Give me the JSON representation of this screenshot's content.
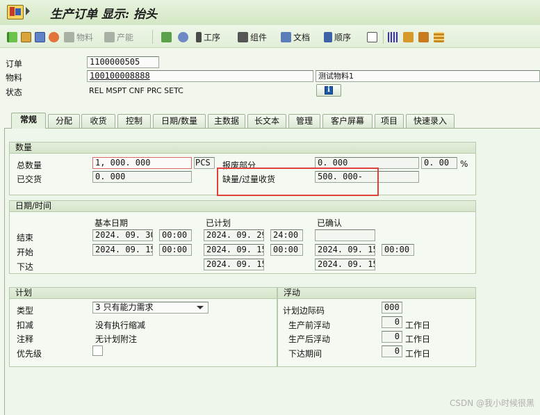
{
  "window": {
    "title": "生产订单 显示: 抬头"
  },
  "toolbar": {
    "material_label": "物料",
    "capacity_label": "产能",
    "operations_label": "工序",
    "components_label": "组件",
    "documents_label": "文档",
    "sequence_label": "顺序"
  },
  "header": {
    "order_label": "订单",
    "order_value": "1100000505",
    "material_label": "物料",
    "material_value": "100100008888",
    "material_desc": "测试物料1",
    "status_label": "状态",
    "status_value": "REL  MSPT CNF  PRC  SETC"
  },
  "tabs": [
    "常规",
    "分配",
    "收货",
    "控制",
    "日期/数量",
    "主数据",
    "长文本",
    "管理",
    "客户屏幕",
    "项目",
    "快速录入"
  ],
  "quantity": {
    "title": "数量",
    "total_label": "总数量",
    "total_value": "1, 000. 000",
    "unit": "PCS",
    "scrap_label": "报废部分",
    "scrap_value": "0. 000",
    "scrap_pct": "0. 00",
    "pct_sign": "%",
    "delivered_label": "已交货",
    "delivered_value": "0. 000",
    "shortage_label": "缺量/过量收货",
    "shortage_value": "500. 000-"
  },
  "dates": {
    "title": "日期/时间",
    "col_basic": "基本日期",
    "col_scheduled": "已计划",
    "col_confirmed": "已确认",
    "end_label": "结束",
    "start_label": "开始",
    "release_label": "下达",
    "end_basic_date": "2024. 09. 30",
    "end_basic_time": "00:00",
    "end_sched_date": "2024. 09. 29",
    "end_sched_time": "24:00",
    "start_basic_date": "2024. 09. 15",
    "start_basic_time": "00:00",
    "start_sched_date": "2024. 09. 15",
    "start_sched_time": "00:00",
    "start_conf_date": "2024. 09. 15",
    "start_conf_time": "00:00",
    "release_sched_date": "2024. 09. 15",
    "release_conf_date": "2024. 09. 15"
  },
  "planning": {
    "title": "计划",
    "type_label": "类型",
    "type_value": "3 只有能力需求",
    "reduction_label": "扣减",
    "reduction_value": "没有执行缩减",
    "note_label": "注释",
    "note_value": "无计划附注",
    "priority_label": "优先级"
  },
  "float": {
    "title": "浮动",
    "margin_key_label": "计划边际码",
    "margin_key_value": "000",
    "before_label": "生产前浮动",
    "before_value": "0",
    "after_label": "生产后浮动",
    "after_value": "0",
    "release_label": "下达期间",
    "release_value": "0",
    "workdays": "工作日"
  },
  "watermark": "CSDN @我小时候很黑",
  "colors": {
    "accent_red": "#e0403a",
    "background": "#f2f7ee"
  }
}
